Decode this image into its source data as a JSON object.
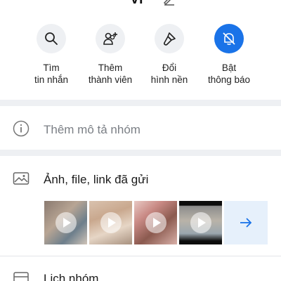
{
  "header": {
    "title": "Vi"
  },
  "actions": [
    {
      "label_line1": "Tìm",
      "label_line2": "tin nhắn",
      "icon": "search-icon"
    },
    {
      "label_line1": "Thêm",
      "label_line2": "thành viên",
      "icon": "add-member-icon"
    },
    {
      "label_line1": "Đổi",
      "label_line2": "hình nền",
      "icon": "paint-brush-icon"
    },
    {
      "label_line1": "Bật",
      "label_line2": "thông báo",
      "icon": "bell-off-icon"
    }
  ],
  "description_row": {
    "text": "Thêm mô tả nhóm",
    "icon": "info-icon"
  },
  "media_row": {
    "title": "Ảnh, file, link đã gửi",
    "icon": "photo-gallery-icon"
  },
  "calendar_row": {
    "text": "Lịch nhóm",
    "icon": "calendar-icon"
  },
  "colors": {
    "accent": "#1a73e8",
    "icon_bg": "#eef0f3",
    "divider": "#eef0f3",
    "more_bg": "#e6f0fb"
  }
}
